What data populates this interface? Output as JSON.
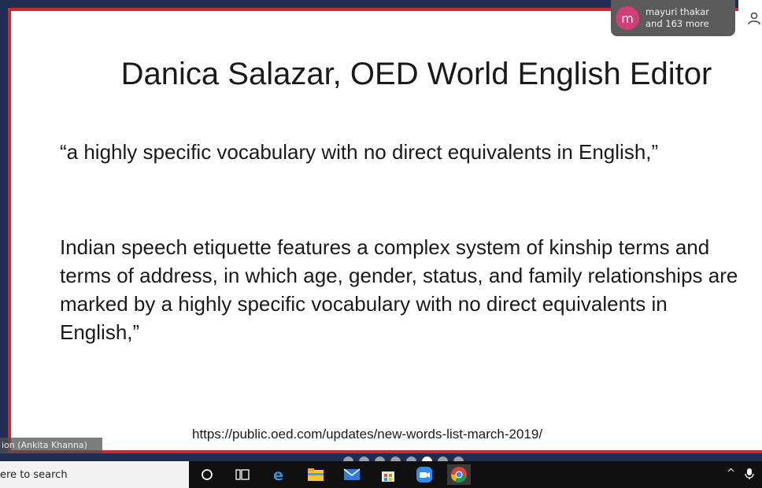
{
  "slide": {
    "title": "Danica Salazar, OED World English Editor",
    "quote_short": "“a highly specific vocabulary with no direct equivalents in English,”",
    "quote_long_lines": [
      "Indian speech etiquette features a complex system of kinship terms and",
      "terms of address, in which age, gender, status, and family relationships are",
      "marked by a highly specific vocabulary with no direct equivalents in",
      "English,”"
    ],
    "source_url": "https://public.oed.com/updates/new-words-list-march-2019/"
  },
  "participants": {
    "avatar_letter": "m",
    "name": "mayuri thakar",
    "more": "and 163 more",
    "avatar_color": "#d23e77"
  },
  "presenter_label": "ion (Ankita Khanna)",
  "slide_dots": {
    "count": 8,
    "active_index": 5
  },
  "taskbar": {
    "search_text": "ere to search",
    "icons": [
      "cortana-icon",
      "task-view-icon",
      "edge-icon",
      "file-explorer-icon",
      "mail-icon",
      "store-icon",
      "zoom-icon",
      "chrome-icon"
    ]
  },
  "colors": {
    "slide_border": "#cc2a2a",
    "background": "#1f2d52"
  }
}
